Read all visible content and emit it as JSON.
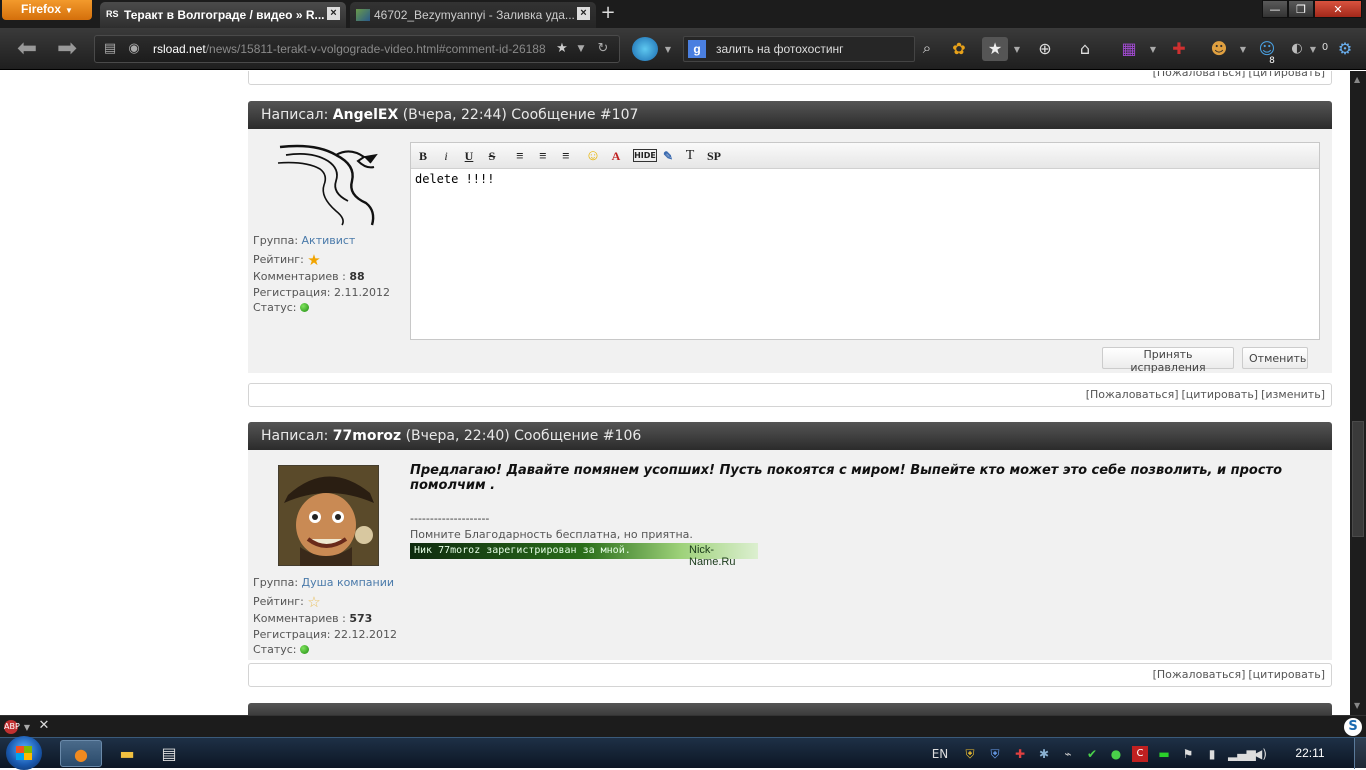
{
  "browser": {
    "firefox_label": "Firefox",
    "tabs": [
      {
        "favicon": "RS",
        "title": "Теракт в Волгограде / видео » R...",
        "close": "×"
      },
      {
        "favicon": "",
        "title": "46702_Bezymyannyi - Заливка уда...",
        "close": "×"
      }
    ],
    "new_tab": "+",
    "window_buttons": {
      "minimize": "—",
      "maximize": "❐",
      "close": "✕"
    },
    "url_host": "rsload.net",
    "url_path": "/news/15811-terakt-v-volgograde-video.html#comment-id-26188",
    "search_value": "залить на фотохостинг",
    "search_engine_letter": "g",
    "notification_count": "8",
    "counter_zero": "0"
  },
  "page": {
    "top_actions": [
      "[Пожаловаться]",
      "[цитировать]"
    ],
    "post107": {
      "prefix": "Написал:",
      "author": "AngelEX",
      "meta": "(Вчера, 22:44) Сообщение #107",
      "group_label": "Группа:",
      "group_value": "Активист",
      "rating_label": "Рейтинг:",
      "comments_label": "Комментариев :",
      "comments_value": "88",
      "reg_label": "Регистрация:",
      "reg_value": "2.11.2012",
      "status_label": "Статус:",
      "editor_text": "delete !!!!",
      "toolbar": {
        "bold": "B",
        "italic": "i",
        "underline": "U",
        "strike": "S",
        "hide": "HIDE",
        "text": "T",
        "sp": "SP"
      },
      "accept_button": "Принять исправления",
      "cancel_button": "Отменить",
      "actions": [
        "[Пожаловаться]",
        "[цитировать]",
        "[изменить]"
      ]
    },
    "post106": {
      "prefix": "Написал:",
      "author": "77moroz",
      "meta": "(Вчера, 22:40) Сообщение #106",
      "message": "Предлагаю! Давайте помянем усопших! Пусть покоятся с миром! Выпейте кто может это себе позволить, и просто помолчим .",
      "sig_separator": "--------------------",
      "sig_text": "Помните Благодарность бесплатна, но приятна.",
      "banner_left": "Ник 77moroz зарегистрирован за мной.",
      "banner_right": "Nick-Name.Ru",
      "group_label": "Группа:",
      "group_value": "Душа компании",
      "rating_label": "Рейтинг:",
      "comments_label": "Комментариев :",
      "comments_value": "573",
      "reg_label": "Регистрация:",
      "reg_value": "22.12.2012",
      "status_label": "Статус:",
      "actions": [
        "[Пожаловаться]",
        "[цитировать]"
      ]
    }
  },
  "taskbar": {
    "language": "EN",
    "clock": "22:11"
  },
  "colors": {
    "post_header": "#3a3a3a",
    "link": "#4a7aaa",
    "status_online": "#2a9a1a",
    "firefox_orange": "#e8840f"
  }
}
